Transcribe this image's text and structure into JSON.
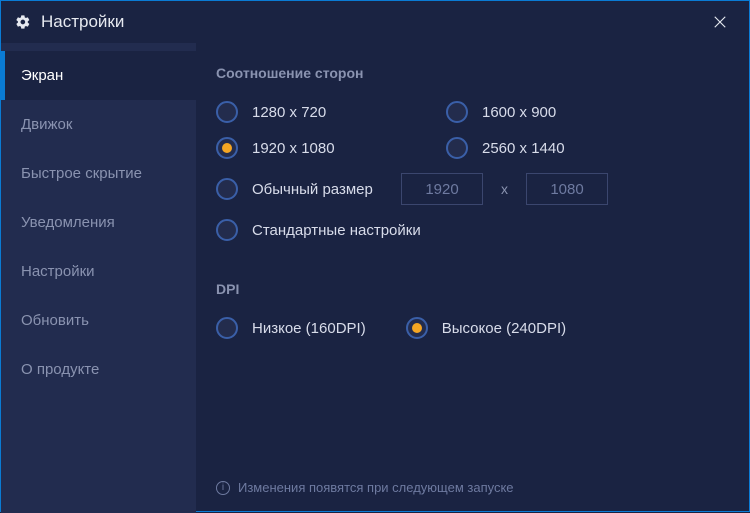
{
  "title": "Настройки",
  "sidebar": {
    "items": [
      {
        "label": "Экран",
        "active": true
      },
      {
        "label": "Движок",
        "active": false
      },
      {
        "label": "Быстрое скрытие",
        "active": false
      },
      {
        "label": "Уведомления",
        "active": false
      },
      {
        "label": "Настройки",
        "active": false
      },
      {
        "label": "Обновить",
        "active": false
      },
      {
        "label": "О продукте",
        "active": false
      }
    ]
  },
  "aspect": {
    "title": "Соотношение сторон",
    "options": [
      {
        "label": "1280 x 720",
        "checked": false
      },
      {
        "label": "1600 x 900",
        "checked": false
      },
      {
        "label": "1920 x 1080",
        "checked": true
      },
      {
        "label": "2560 x 1440",
        "checked": false
      }
    ],
    "custom": {
      "label": "Обычный размер",
      "checked": false,
      "width_value": "1920",
      "height_value": "1080",
      "separator": "x"
    },
    "default": {
      "label": "Стандартные настройки",
      "checked": false
    }
  },
  "dpi": {
    "title": "DPI",
    "options": [
      {
        "label": "Низкое (160DPI)",
        "checked": false
      },
      {
        "label": "Высокое (240DPI)",
        "checked": true
      }
    ]
  },
  "notice": "Изменения появятся при следующем запуске"
}
